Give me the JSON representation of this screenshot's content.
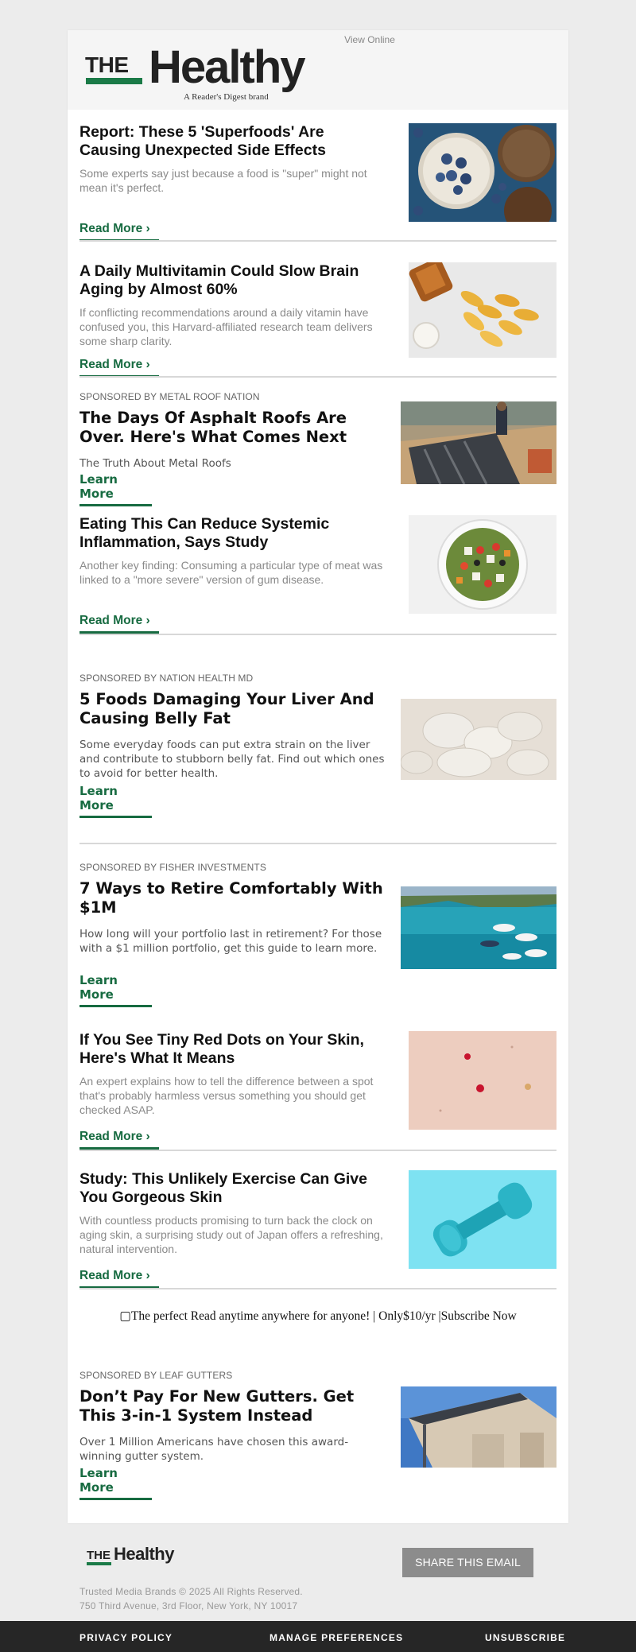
{
  "header": {
    "view_online": "View Online",
    "logo_the": "THE",
    "logo_healthy": "Healthy",
    "logo_sub": "A Reader's Digest brand"
  },
  "articles": [
    {
      "title": "Report: These 5 'Superfoods' Are Causing Unexpected Side Effects",
      "desc": "Some experts say just because a food is \"super\" might not mean it's perfect.",
      "cta": "Read More ›",
      "image": "superfoods-bowls-image"
    },
    {
      "title": "A Daily Multivitamin Could Slow Brain Aging by Almost 60%",
      "desc": "If conflicting recommendations around a daily vitamin have confused you, this Harvard-affiliated research team delivers some sharp clarity.",
      "cta": "Read More ›",
      "image": "multivitamin-pills-image"
    },
    {
      "sponsor": "SPONSORED BY METAL ROOF NATION",
      "title": "The Days Of Asphalt Roofs Are Over. Here's What Comes Next",
      "desc": "The Truth About Metal Roofs",
      "cta": "Learn More",
      "image": "metal-roof-image"
    },
    {
      "title": "Eating This Can Reduce Systemic Inflammation, Says Study",
      "desc": "Another key finding: Consuming a particular type of meat was linked to a \"more severe\" version of gum disease.",
      "cta": "Read More ›",
      "image": "salad-bowl-image"
    },
    {
      "sponsor": "SPONSORED BY NATION HEALTH MD",
      "title": "5 Foods Damaging Your Liver And Causing Belly Fat",
      "desc": "Some everyday foods can put extra strain on the liver and contribute to stubborn belly fat. Find out which ones to avoid for better health.",
      "cta": "Learn More",
      "image": "squid-image"
    },
    {
      "sponsor": "SPONSORED BY FISHER INVESTMENTS",
      "title": "7 Ways to Retire Comfortably With $1M",
      "desc": "How long will your portfolio last in retirement? For those with a $1 million portfolio, get this guide to learn more.",
      "cta": "Learn More",
      "image": "harbor-boats-image"
    },
    {
      "title": "If You See Tiny Red Dots on Your Skin, Here's What It Means",
      "desc": "An expert explains how to tell the difference between a spot that's probably harmless versus something you should get checked ASAP.",
      "cta": "Read More ›",
      "image": "skin-dots-image"
    },
    {
      "title": "Study: This Unlikely Exercise Can Give You Gorgeous Skin",
      "desc": "With countless products promising to turn back the clock on aging skin, a surprising study out of Japan offers a refreshing, natural intervention.",
      "cta": "Read More ›",
      "image": "dumbbell-image"
    },
    {
      "sponsor": "SPONSORED BY LEAF GUTTERS",
      "title": "Don’t Pay For New Gutters. Get This 3-in-1 System Instead",
      "desc": "Over 1 Million Americans have chosen this award-winning gutter system.",
      "cta": "Learn More",
      "image": "house-gutter-image"
    }
  ],
  "banner_alt": "The perfect Read anytime anywhere for anyone! | Only$10/yr |Subscribe Now",
  "footer": {
    "logo_the": "THE",
    "logo_healthy": "Healthy",
    "share_button": "SHARE THIS EMAIL",
    "copyright": "Trusted Media Brands © 2025 All Rights Reserved.",
    "address": "750 Third Avenue, 3rd Floor, New York, NY 10017",
    "links": [
      "PRIVACY POLICY",
      "MANAGE PREFERENCES",
      "UNSUBSCRIBE"
    ]
  },
  "colors": {
    "brand_green": "#176b41",
    "page_bg": "#ececec",
    "footer_bar": "#262626",
    "share_button": "#8c8c8c"
  }
}
